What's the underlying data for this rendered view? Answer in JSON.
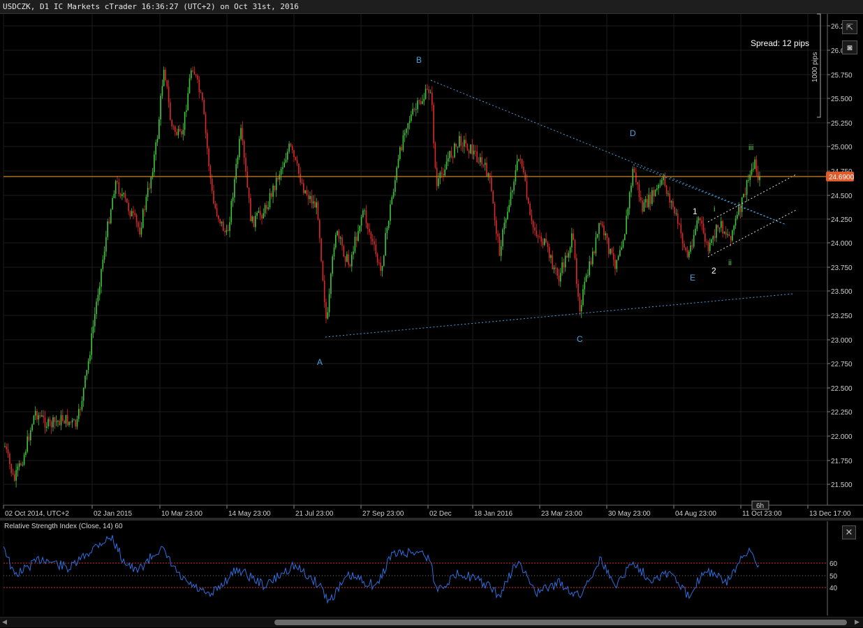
{
  "window": {
    "title": "USDCZK, D1 IC Markets cTrader 16:36:27 (UTC+2) on Oct 31st, 2016"
  },
  "toolbar": {
    "spread_label": "Spread: 12 pips",
    "scale_label": "1000 pips",
    "popout_icon": "popout-icon",
    "screenshot_icon": "camera-icon"
  },
  "price_axis": {
    "ticks": [
      "26.2",
      "26.000",
      "25.750",
      "25.500",
      "25.250",
      "25.000",
      "24.750",
      "24.500",
      "24.250",
      "24.000",
      "23.750",
      "23.500",
      "23.250",
      "23.000",
      "22.750",
      "22.500",
      "22.250",
      "22.000",
      "21.750",
      "21.500"
    ],
    "current_price": "24.6900",
    "current_price_color": "#e05a2b"
  },
  "time_axis": {
    "labels": [
      "02 Oct 2014, UTC+2",
      "02 Jan 2015",
      "10 Mar 23:00",
      "14 May 23:00",
      "21 Jul 23:00",
      "27 Sep 23:00",
      "02 Dec",
      "18 Jan 2016",
      "23 Mar 23:00",
      "30 May 23:00",
      "04 Aug 23:00",
      "11 Oct 23:00",
      "13 Dec 17:00"
    ],
    "timeframe_badge": "6h"
  },
  "wave_labels": {
    "A": "A",
    "B": "B",
    "C": "C",
    "D": "D",
    "E": "E",
    "one": "1",
    "two": "2",
    "i": "i",
    "ii": "ii",
    "iii": "iii"
  },
  "colors": {
    "bull": "#3fc93a",
    "bear": "#e0282a",
    "trend_blue": "#4aa3df",
    "rsi": "#2f6fe0",
    "level_line": "#c8861f"
  },
  "rsi": {
    "title": "Relative Strength Index (Close, 14) 60",
    "levels": [
      "60",
      "50",
      "40"
    ],
    "close_icon": "close-icon"
  }
}
